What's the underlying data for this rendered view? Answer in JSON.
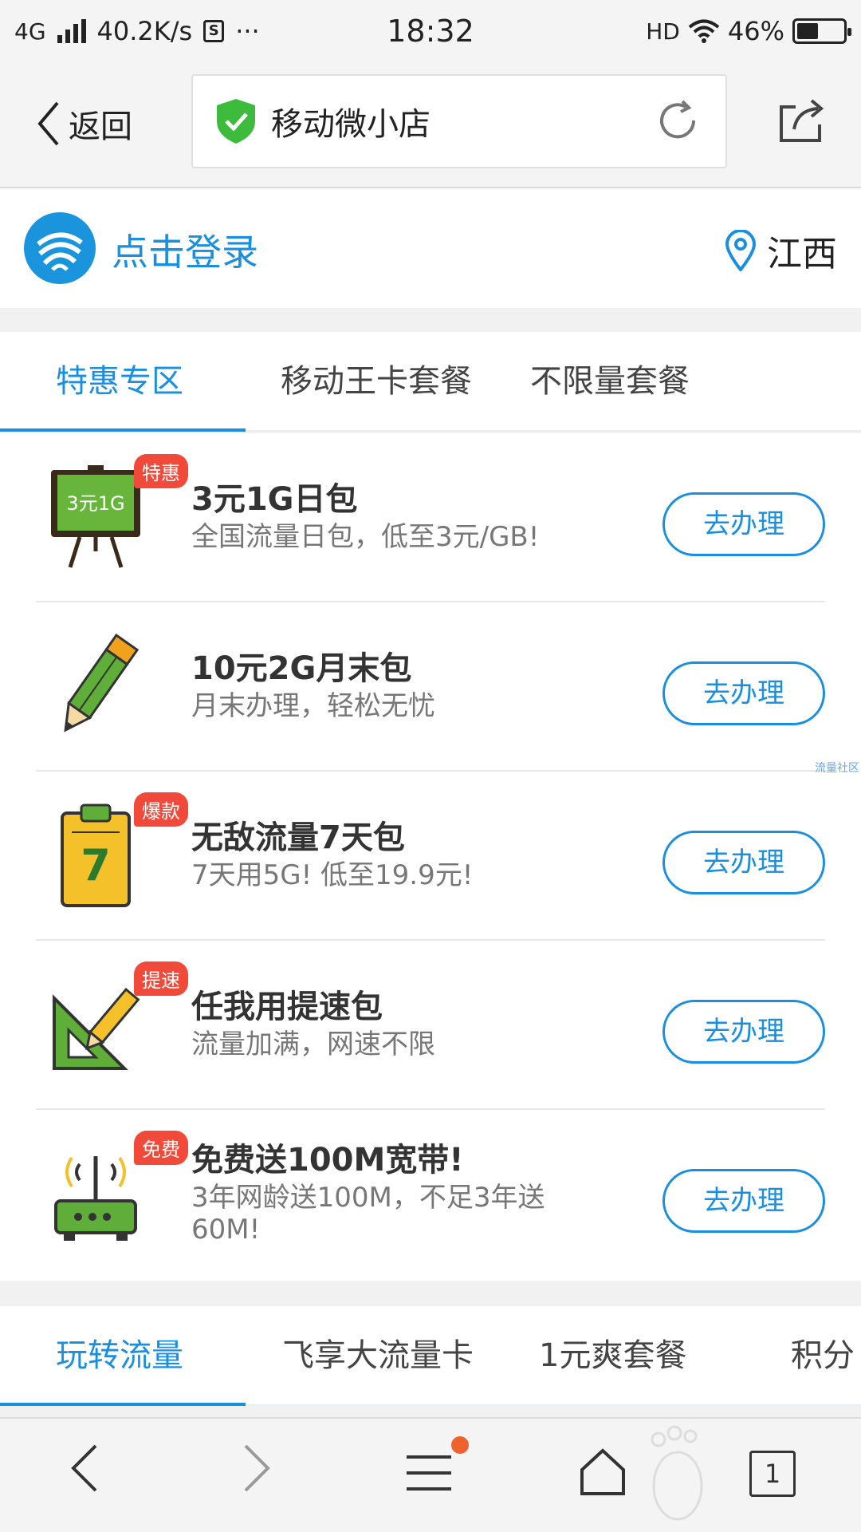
{
  "status_bar": {
    "network": "4G",
    "speed": "40.2K/s",
    "s_icon": "S",
    "more": "···",
    "time": "18:32",
    "hd": "HD",
    "battery": "46%",
    "battery_level": 0.46
  },
  "browser": {
    "back_label": "返回",
    "page_title": "移动微小店",
    "icons": [
      "chevron-left-icon",
      "shield-check-icon",
      "reload-icon",
      "share-icon"
    ]
  },
  "header": {
    "login": "点击登录",
    "location": "江西",
    "brand_color": "#1a8fe0"
  },
  "tabs": {
    "items": [
      "特惠专区",
      "移动王卡套餐",
      "不限量套餐"
    ],
    "active": 0
  },
  "products": [
    {
      "badge": "特惠",
      "icon": "chalkboard-icon",
      "icon_text": "3元1G",
      "name": "3元1G日包",
      "desc": "全国流量日包，低至3元/GB!",
      "button": "去办理"
    },
    {
      "badge": "",
      "icon": "pencil-icon",
      "name": "10元2G月末包",
      "desc": "月末办理，轻松无忧",
      "button": "去办理"
    },
    {
      "badge": "爆款",
      "icon": "clipboard-icon",
      "icon_text": "7",
      "name": "无敌流量7天包",
      "desc": "7天用5G! 低至19.9元!",
      "button": "去办理"
    },
    {
      "badge": "提速",
      "icon": "ruler-triangle-icon",
      "name": "任我用提速包",
      "desc": "流量加满，网速不限",
      "button": "去办理"
    },
    {
      "badge": "免费",
      "icon": "router-icon",
      "name": "免费送100M宽带!",
      "desc": "3年网龄送100M，不足3年送60M!",
      "button": "去办理"
    }
  ],
  "watermark": "流量社区",
  "tabs2": {
    "items": [
      "玩转流量",
      "飞享大流量卡",
      "1元爽套餐",
      "积分"
    ],
    "active": 0
  },
  "bottom_bar": {
    "tab_count": "1",
    "icons": [
      "back-icon",
      "forward-icon",
      "menu-icon",
      "home-icon",
      "tabs-icon"
    ]
  }
}
